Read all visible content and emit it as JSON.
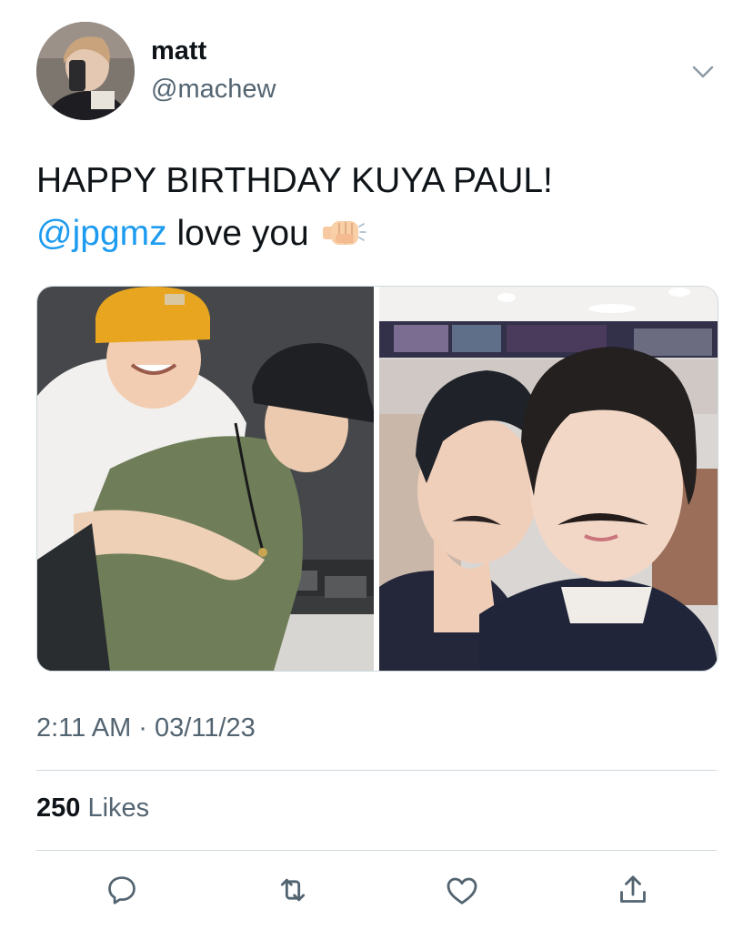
{
  "author": {
    "name": "matt",
    "handle": "@machew"
  },
  "tweet": {
    "line1": "HAPPY BIRTHDAY KUYA PAUL!",
    "mention": "@jpgmz",
    "line2_rest": " love you",
    "emoji": "fist-bump-emoji"
  },
  "media": {
    "count": 2
  },
  "meta": {
    "timestamp": "2:11 AM · 03/11/23",
    "likes_count": "250",
    "likes_label": " Likes"
  },
  "actions": [
    "reply-icon",
    "retweet-icon",
    "like-icon",
    "share-icon"
  ],
  "colors": {
    "accent": "#1d9bf0",
    "secondary_text": "#536471",
    "divider": "#cfd9de"
  }
}
